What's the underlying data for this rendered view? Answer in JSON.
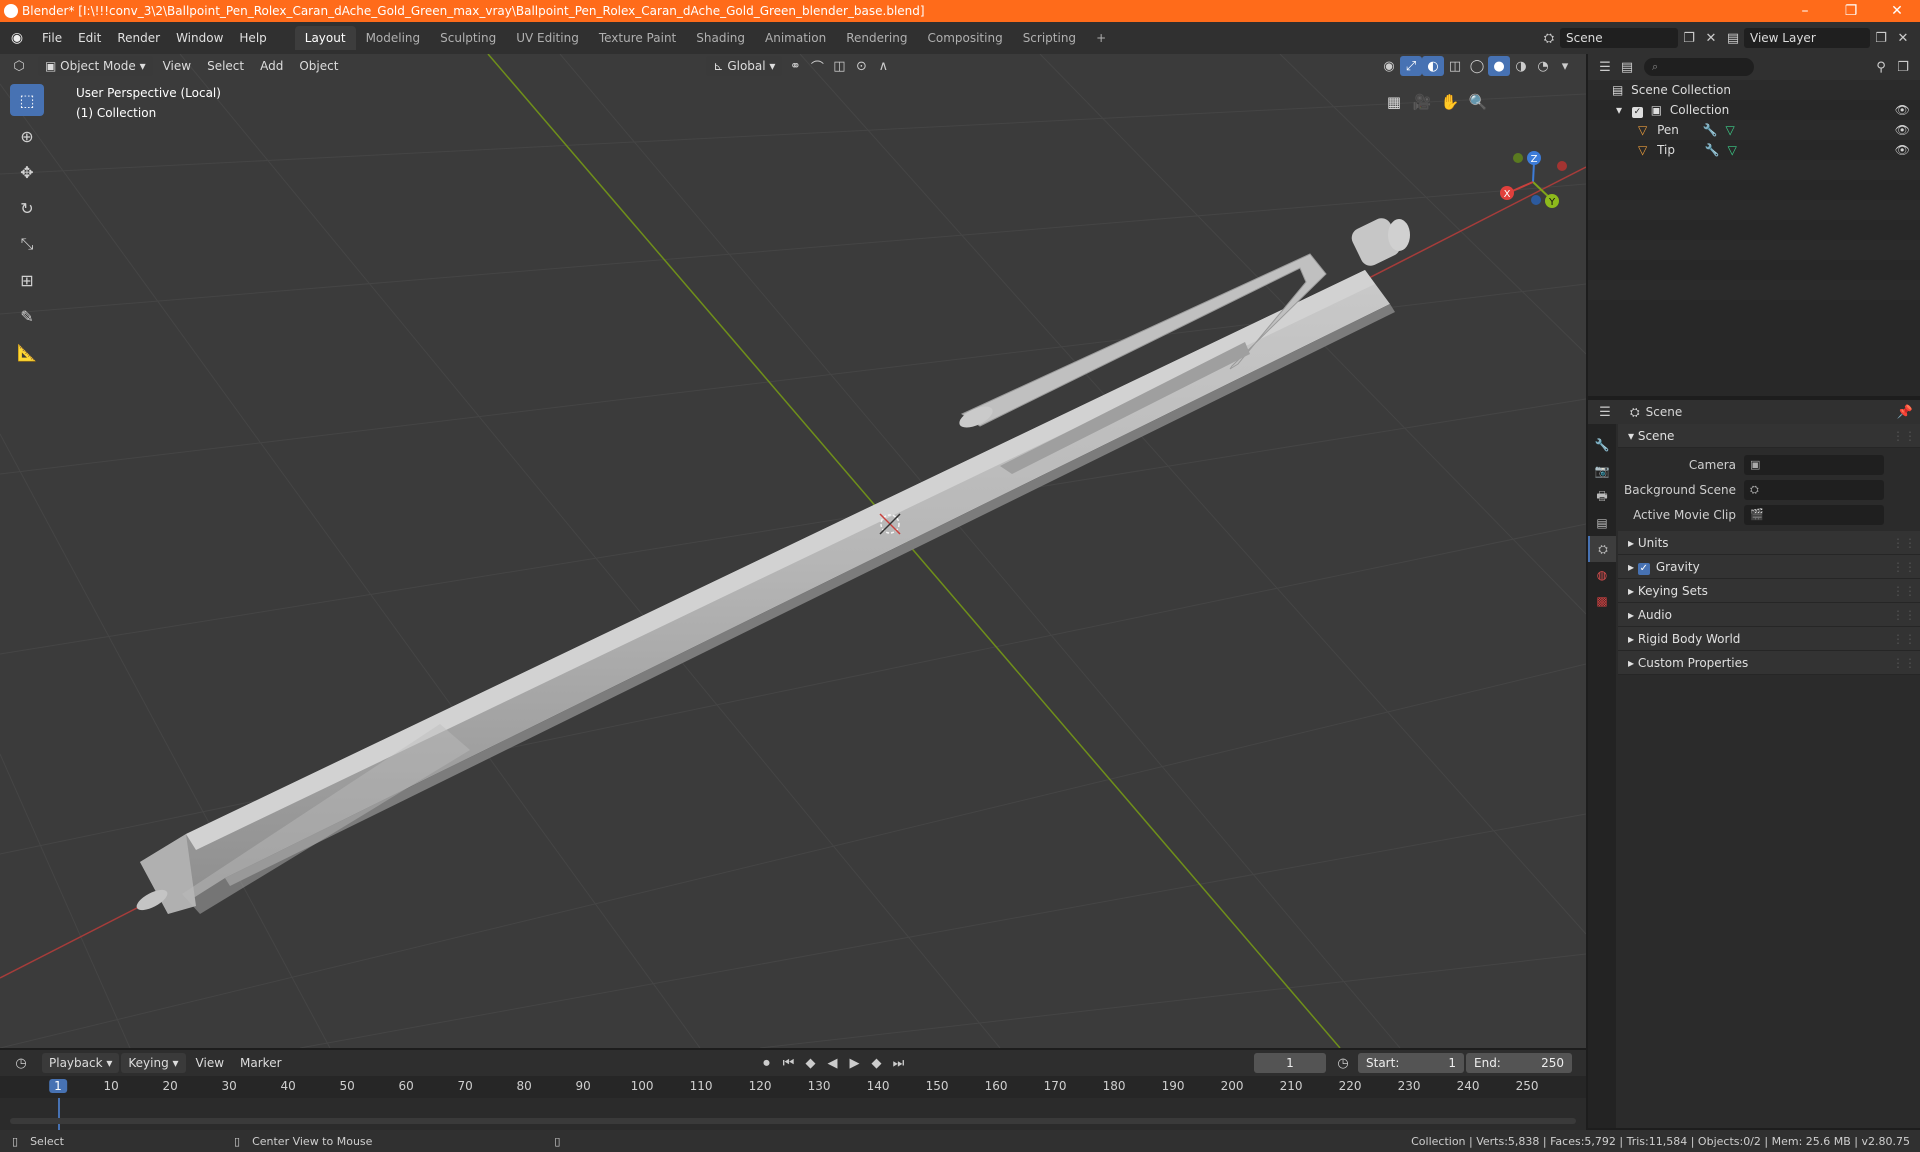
{
  "window": {
    "title": "Blender* [I:\\!!!conv_3\\2\\Ballpoint_Pen_Rolex_Caran_dAche_Gold_Green_max_vray\\Ballpoint_Pen_Rolex_Caran_dAche_Gold_Green_blender_base.blend]",
    "minimize": "–",
    "maximize": "❐",
    "close": "✕"
  },
  "menu": [
    "File",
    "Edit",
    "Render",
    "Window",
    "Help"
  ],
  "workspaces": [
    "Layout",
    "Modeling",
    "Sculpting",
    "UV Editing",
    "Texture Paint",
    "Shading",
    "Animation",
    "Rendering",
    "Compositing",
    "Scripting"
  ],
  "active_workspace": "Layout",
  "add_workspace": "+",
  "scene_name": "Scene",
  "view_layer": "View Layer",
  "viewport": {
    "mode": "Object Mode",
    "menus": [
      "View",
      "Select",
      "Add",
      "Object"
    ],
    "orientation": "Global",
    "overlay_line1": "User Perspective (Local)",
    "overlay_line2": "(1) Collection",
    "gizmo": {
      "x": "X",
      "y": "Y",
      "z": "Z"
    }
  },
  "outliner": {
    "root": "Scene Collection",
    "collection": "Collection",
    "objects": [
      "Pen",
      "Tip"
    ]
  },
  "properties": {
    "context": "Scene",
    "panel_scene": "Scene",
    "camera_label": "Camera",
    "background_scene_label": "Background Scene",
    "active_clip_label": "Active Movie Clip",
    "panels": [
      "Units",
      "Gravity",
      "Keying Sets",
      "Audio",
      "Rigid Body World",
      "Custom Properties"
    ],
    "gravity_checked": true
  },
  "timeline": {
    "menus": [
      "Playback",
      "Keying",
      "View",
      "Marker"
    ],
    "current_frame": "1",
    "start_label": "Start:",
    "start": "1",
    "end_label": "End:",
    "end": "250",
    "ticks": [
      1,
      10,
      20,
      30,
      40,
      50,
      60,
      70,
      80,
      90,
      100,
      110,
      120,
      130,
      140,
      150,
      160,
      170,
      180,
      190,
      200,
      210,
      220,
      230,
      240,
      250
    ]
  },
  "status": {
    "left1": "Select",
    "left2": "Center View to Mouse",
    "right": "Collection | Verts:5,838 | Faces:5,792 | Tris:11,584 | Objects:0/2 | Mem: 25.6 MB | v2.80.75"
  },
  "colors": {
    "titlebar": "#ff6b1a",
    "accent": "#4772b3",
    "x_axis": "#c8403c",
    "y_axis": "#7fa31a",
    "z_axis": "#3d7cd8"
  }
}
